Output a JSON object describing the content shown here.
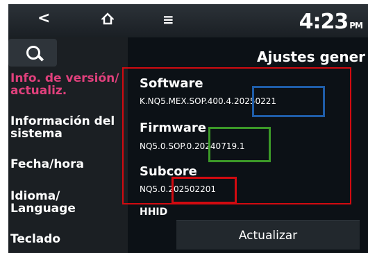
{
  "topbar": {
    "back_glyph": "<",
    "home_icon": "home-icon",
    "menu_icon": "menu-icon",
    "time": "4:23",
    "ampm": "PM"
  },
  "header": {
    "title": "Ajustes gener"
  },
  "sidebar": {
    "items": [
      {
        "label": "Info. de versión/ actualiz.",
        "active": true
      },
      {
        "label": "Información del sistema"
      },
      {
        "label": "Fecha/hora"
      },
      {
        "label": "Idioma/ Language"
      },
      {
        "label": "Teclado"
      }
    ]
  },
  "version_info": {
    "software_label": "Software",
    "software_value": "K.NQ5.MEX.SOP.400.4.20250221",
    "firmware_label": "Firmware",
    "firmware_value": "NQ5.0.SOP.0.20240719.1",
    "subcore_label": "Subcore",
    "subcore_value": "NQ5.0.202502201",
    "next_label_partial": "HHID"
  },
  "actions": {
    "update_label": "Actualizar"
  },
  "colors": {
    "accent_active": "#e0407c",
    "highlight_red": "#d20a10",
    "highlight_blue": "#1f5da8",
    "highlight_green": "#3c9a28"
  }
}
